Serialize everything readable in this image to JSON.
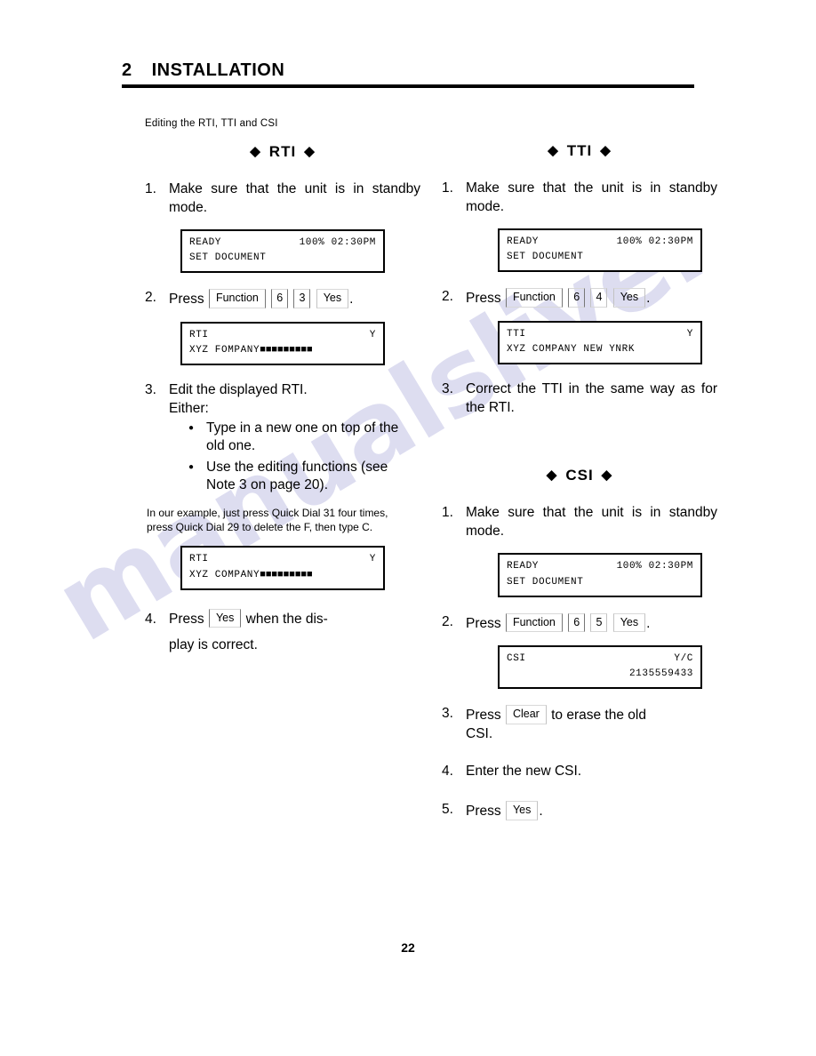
{
  "header": {
    "chapter_number": "2",
    "chapter_title": "INSTALLATION"
  },
  "subhead": "Editing the RTI, TTI and CSI",
  "diamond": "◆",
  "sections": {
    "rti": {
      "title": "RTI",
      "step1": {
        "number": "1.",
        "text": "Make sure that the unit is in standby mode."
      },
      "display1": {
        "line1_left": "READY",
        "line1_right": "100% 02:30PM",
        "line2": "SET DOCUMENT"
      },
      "step2": {
        "number": "2.",
        "press": "Press",
        "keys": [
          "Function",
          "6",
          "3",
          "Yes"
        ],
        "period": "."
      },
      "display2": {
        "line1_left": "RTI",
        "line1_right": "Y",
        "line2_text": "XYZ FOMPANY",
        "line2_blocks": "■■■■■■■■■"
      },
      "step3": {
        "number": "3.",
        "line1": "Edit the displayed RTI.",
        "line2": "Either:",
        "bullets": [
          "Type in a new one on top of the old one.",
          "Use the editing functions (see Note 3 on page 20)."
        ]
      },
      "note": "In our example, just press Quick Dial 31 four times, press Quick Dial 29 to delete the F, then type C.",
      "display3": {
        "line1_left": "RTI",
        "line1_right": "Y",
        "line2_text": "XYZ COMPANY",
        "line2_blocks": "■■■■■■■■■"
      },
      "step4": {
        "number": "4.",
        "press": "Press",
        "key": "Yes",
        "after": "when the dis-",
        "line2": "play is correct."
      }
    },
    "tti": {
      "title": "TTI",
      "step1": {
        "number": "1.",
        "text": "Make sure that the unit is in standby mode."
      },
      "display1": {
        "line1_left": "READY",
        "line1_right": "100% 02:30PM",
        "line2": "SET DOCUMENT"
      },
      "step2": {
        "number": "2.",
        "press": "Press",
        "keys": [
          "Function",
          "6",
          "4",
          "Yes"
        ],
        "period": "."
      },
      "display2": {
        "line1_left": "TTI",
        "line1_right": "Y",
        "line2": "XYZ COMPANY NEW YNRK"
      },
      "step3": {
        "number": "3.",
        "text": "Correct the TTI in the same way as for the RTI."
      }
    },
    "csi": {
      "title": "CSI",
      "step1": {
        "number": "1.",
        "text": "Make sure that the unit is in standby mode."
      },
      "display1": {
        "line1_left": "READY",
        "line1_right": "100% 02:30PM",
        "line2": "SET DOCUMENT"
      },
      "step2": {
        "number": "2.",
        "press": "Press",
        "keys": [
          "Function",
          "6",
          "5",
          "Yes"
        ],
        "period": "."
      },
      "display2": {
        "line1_left": "CSI",
        "line1_right": "Y/C",
        "line2": "2135559433"
      },
      "step3": {
        "number": "3.",
        "press": "Press",
        "key": "Clear",
        "after": "to erase the old",
        "line2": "CSI."
      },
      "step4": {
        "number": "4.",
        "text": "Enter the new CSI."
      },
      "step5": {
        "number": "5.",
        "press": "Press",
        "key": "Yes",
        "period": "."
      }
    }
  },
  "watermark": {
    "text": "manualslive.com",
    "color": "#c9c9e8"
  },
  "page_number": "22"
}
